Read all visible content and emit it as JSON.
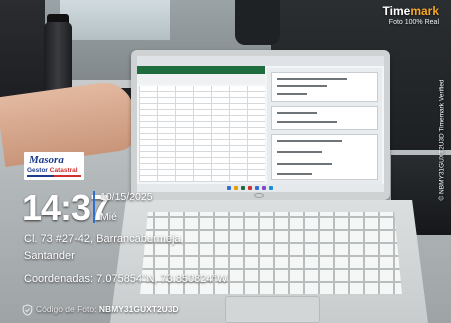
{
  "watermark": {
    "brand_prefix": "Time",
    "brand_suffix": "mark",
    "subtitle": "Foto 100% Real",
    "vertical_id": "© NBMY31GUXT2U3D  Timemark Verified"
  },
  "logo": {
    "title": "Masora",
    "sub_left": "Gestor ",
    "sub_right": "Catastral"
  },
  "stamp": {
    "time": "14:37",
    "date": "10/15/2025",
    "weekday": "Mié",
    "address_line1": "Cl. 73 #27-42, Barrancabermeja,",
    "address_line2": "Santander",
    "coordinates": "Coordenadas: 7.075854°N, 73.850824°W",
    "photo_code_label": "Código de Foto: ",
    "photo_code": "NBMY31GUXT2U3D"
  },
  "colors": {
    "brand_accent": "#f5a623",
    "logo_blue": "#1c3c8a",
    "logo_red": "#d0312d",
    "divider_blue": "#2f6fd1",
    "excel_green": "#1f6c3f"
  },
  "icons": {
    "shield": "shield-check-icon"
  }
}
